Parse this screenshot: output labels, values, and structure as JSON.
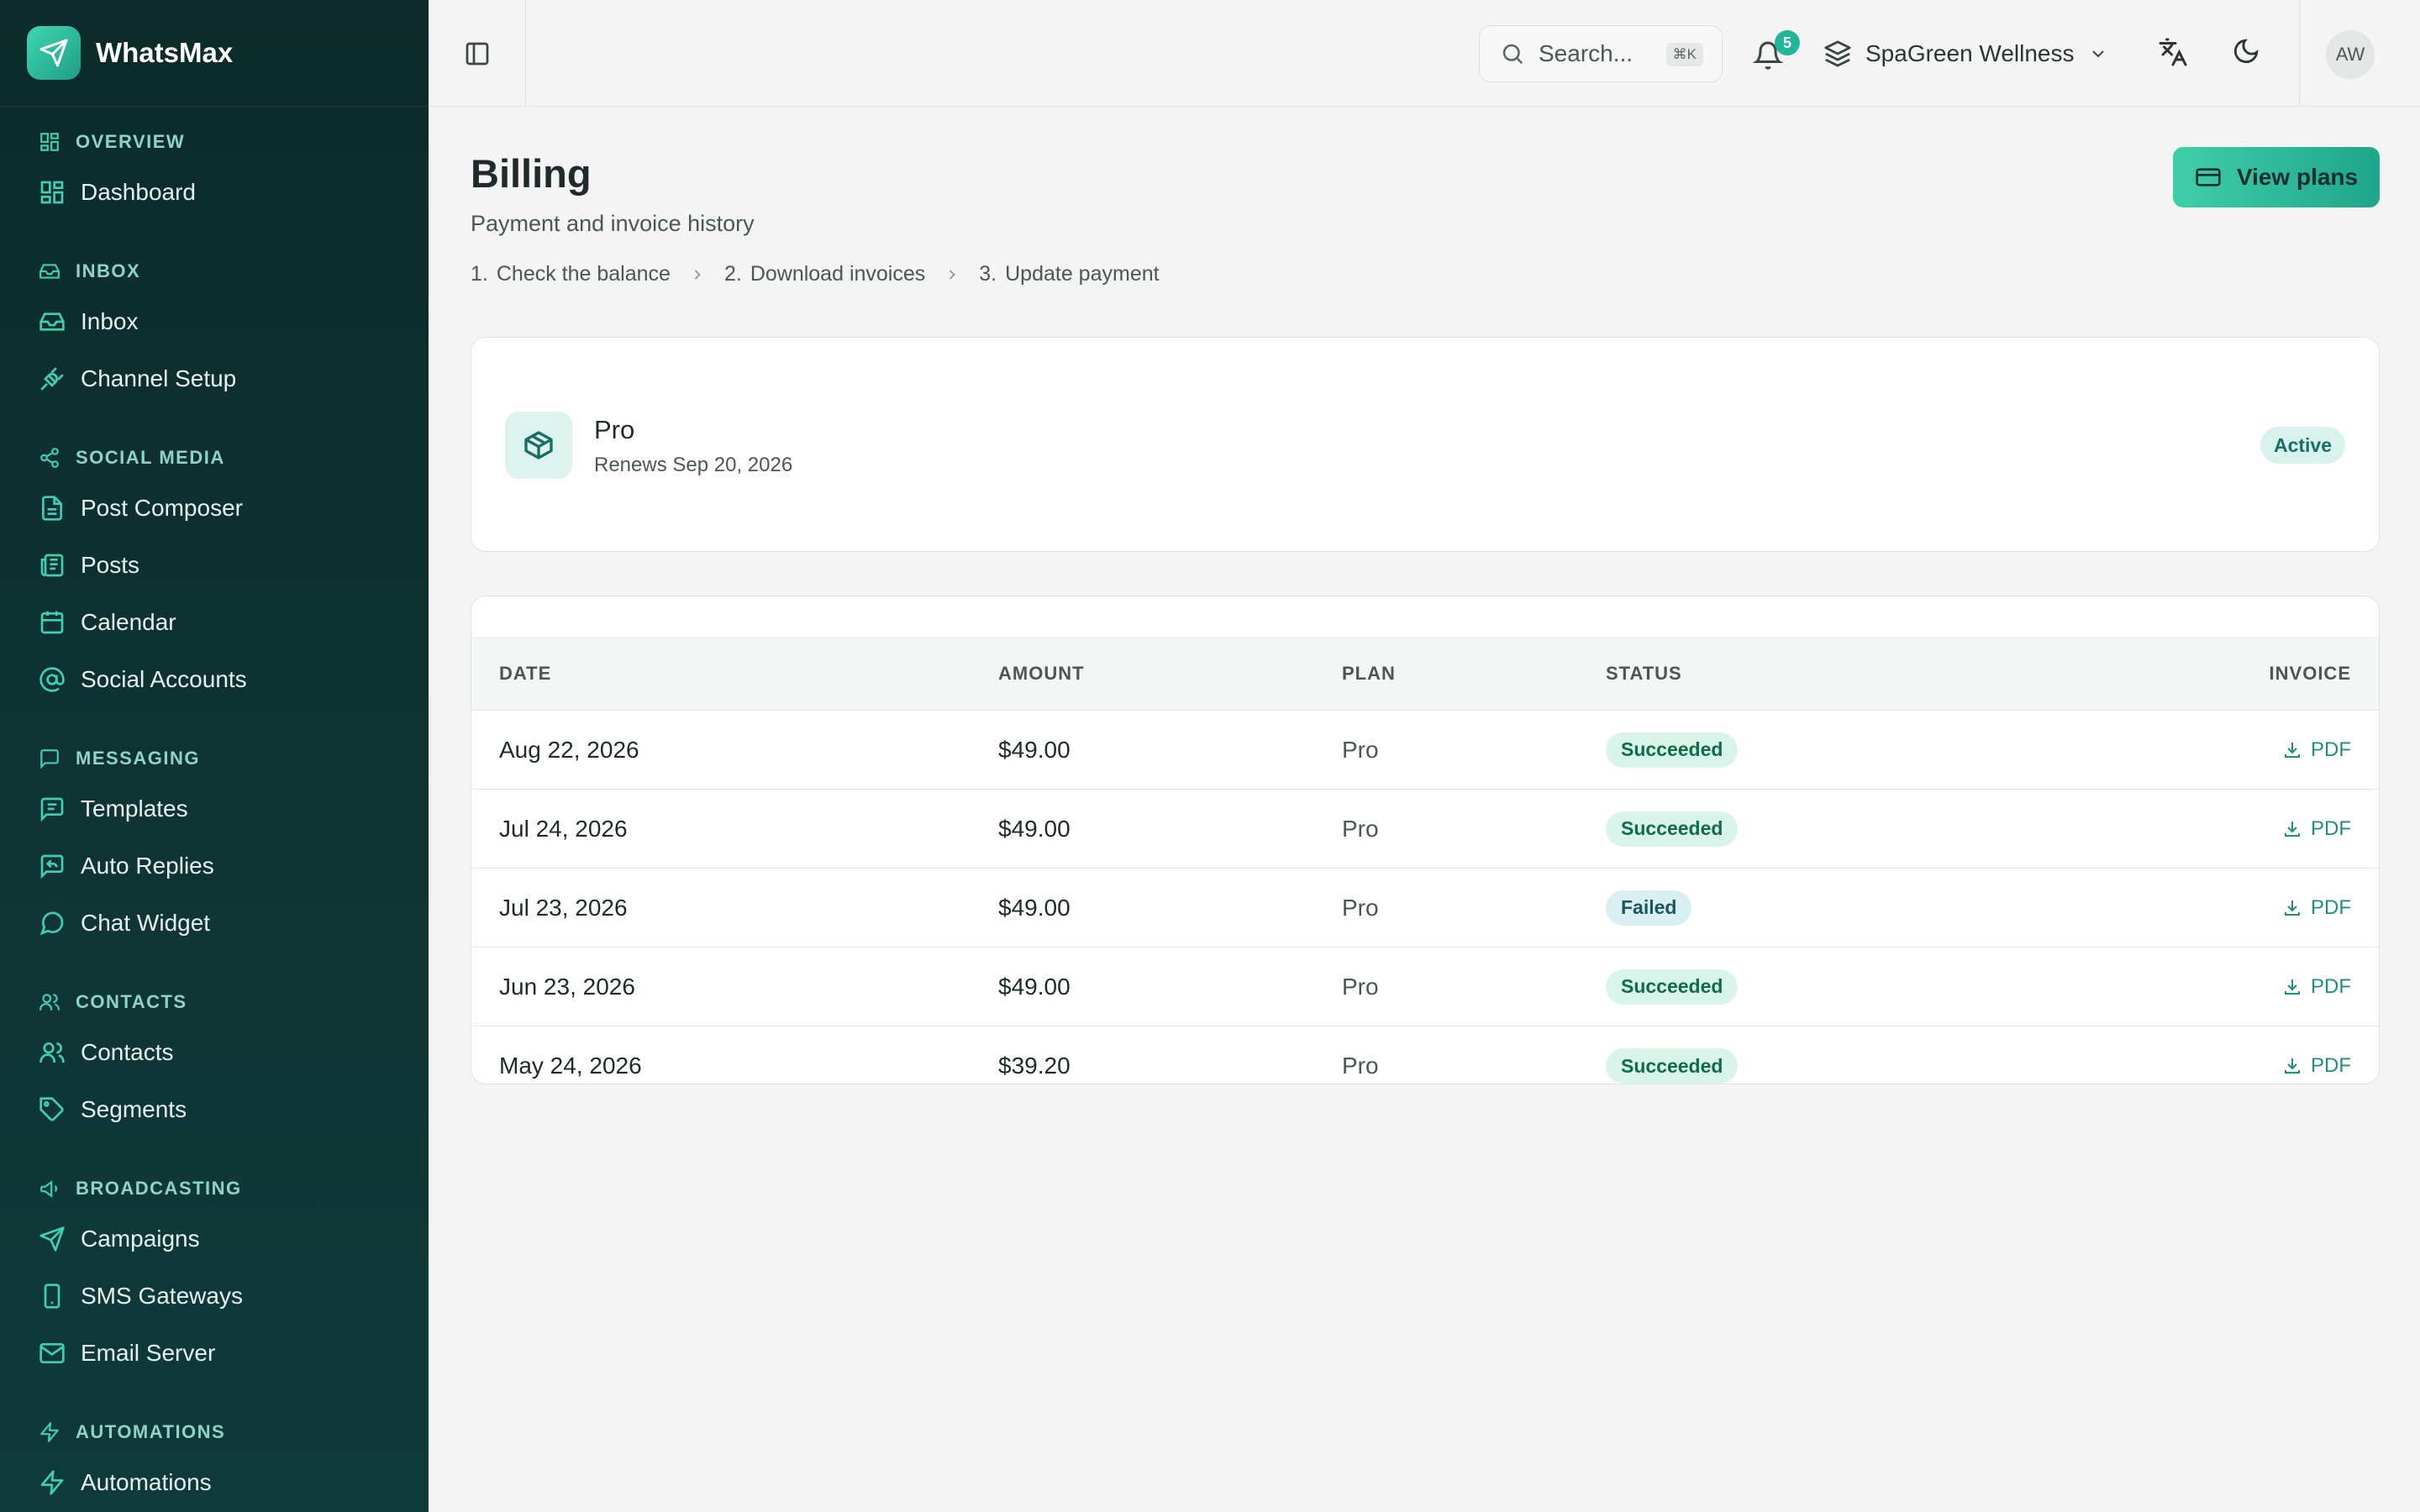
{
  "brand": {
    "name": "WhatsMax"
  },
  "sidebar": {
    "sections": [
      {
        "heading": "OVERVIEW",
        "heading_icon": "grid-icon",
        "items": [
          {
            "label": "Dashboard",
            "icon": "grid-icon"
          }
        ]
      },
      {
        "heading": "INBOX",
        "heading_icon": "inbox-icon",
        "items": [
          {
            "label": "Inbox",
            "icon": "inbox-icon"
          },
          {
            "label": "Channel Setup",
            "icon": "plug-icon"
          }
        ]
      },
      {
        "heading": "SOCIAL MEDIA",
        "heading_icon": "share-icon",
        "items": [
          {
            "label": "Post Composer",
            "icon": "file-icon"
          },
          {
            "label": "Posts",
            "icon": "newspaper-icon"
          },
          {
            "label": "Calendar",
            "icon": "calendar-icon"
          },
          {
            "label": "Social Accounts",
            "icon": "at-sign-icon"
          }
        ]
      },
      {
        "heading": "MESSAGING",
        "heading_icon": "message-square-icon",
        "items": [
          {
            "label": "Templates",
            "icon": "message-lines-icon"
          },
          {
            "label": "Auto Replies",
            "icon": "reply-icon"
          },
          {
            "label": "Chat Widget",
            "icon": "chat-bubble-icon"
          }
        ]
      },
      {
        "heading": "CONTACTS",
        "heading_icon": "users-icon",
        "items": [
          {
            "label": "Contacts",
            "icon": "users-icon"
          },
          {
            "label": "Segments",
            "icon": "tag-icon"
          }
        ]
      },
      {
        "heading": "BROADCASTING",
        "heading_icon": "megaphone-icon",
        "items": [
          {
            "label": "Campaigns",
            "icon": "send-icon"
          },
          {
            "label": "SMS Gateways",
            "icon": "smartphone-icon"
          },
          {
            "label": "Email Server",
            "icon": "mail-icon"
          }
        ]
      },
      {
        "heading": "AUTOMATIONS",
        "heading_icon": "zap-icon",
        "items": [
          {
            "label": "Automations",
            "icon": "zap-icon"
          }
        ]
      }
    ]
  },
  "topbar": {
    "search_placeholder": "Search...",
    "search_shortcut": "⌘K",
    "notifications_count": "5",
    "workspace": "SpaGreen Wellness",
    "avatar_initials": "AW"
  },
  "page": {
    "title": "Billing",
    "subtitle": "Payment and invoice history",
    "view_plans_label": "View plans",
    "steps": [
      {
        "num": "1.",
        "label": "Check the balance"
      },
      {
        "num": "2.",
        "label": "Download invoices"
      },
      {
        "num": "3.",
        "label": "Update payment"
      }
    ]
  },
  "plan": {
    "name": "Pro",
    "renews": "Renews Sep 20, 2026",
    "status": "Active"
  },
  "invoices": {
    "columns": [
      "DATE",
      "AMOUNT",
      "PLAN",
      "STATUS",
      "INVOICE"
    ],
    "rows": [
      {
        "date": "Aug 22, 2026",
        "amount": "$49.00",
        "plan": "Pro",
        "status": "Succeeded",
        "invoice": "PDF"
      },
      {
        "date": "Jul 24, 2026",
        "amount": "$49.00",
        "plan": "Pro",
        "status": "Succeeded",
        "invoice": "PDF"
      },
      {
        "date": "Jul 23, 2026",
        "amount": "$49.00",
        "plan": "Pro",
        "status": "Failed",
        "invoice": "PDF"
      },
      {
        "date": "Jun 23, 2026",
        "amount": "$49.00",
        "plan": "Pro",
        "status": "Succeeded",
        "invoice": "PDF"
      },
      {
        "date": "May 24, 2026",
        "amount": "$39.20",
        "plan": "Pro",
        "status": "Succeeded",
        "invoice": "PDF"
      }
    ]
  },
  "colors": {
    "accent": "#22b59a",
    "sidebar_bg": "#0f3433",
    "success_bg": "#d9f5ea"
  }
}
